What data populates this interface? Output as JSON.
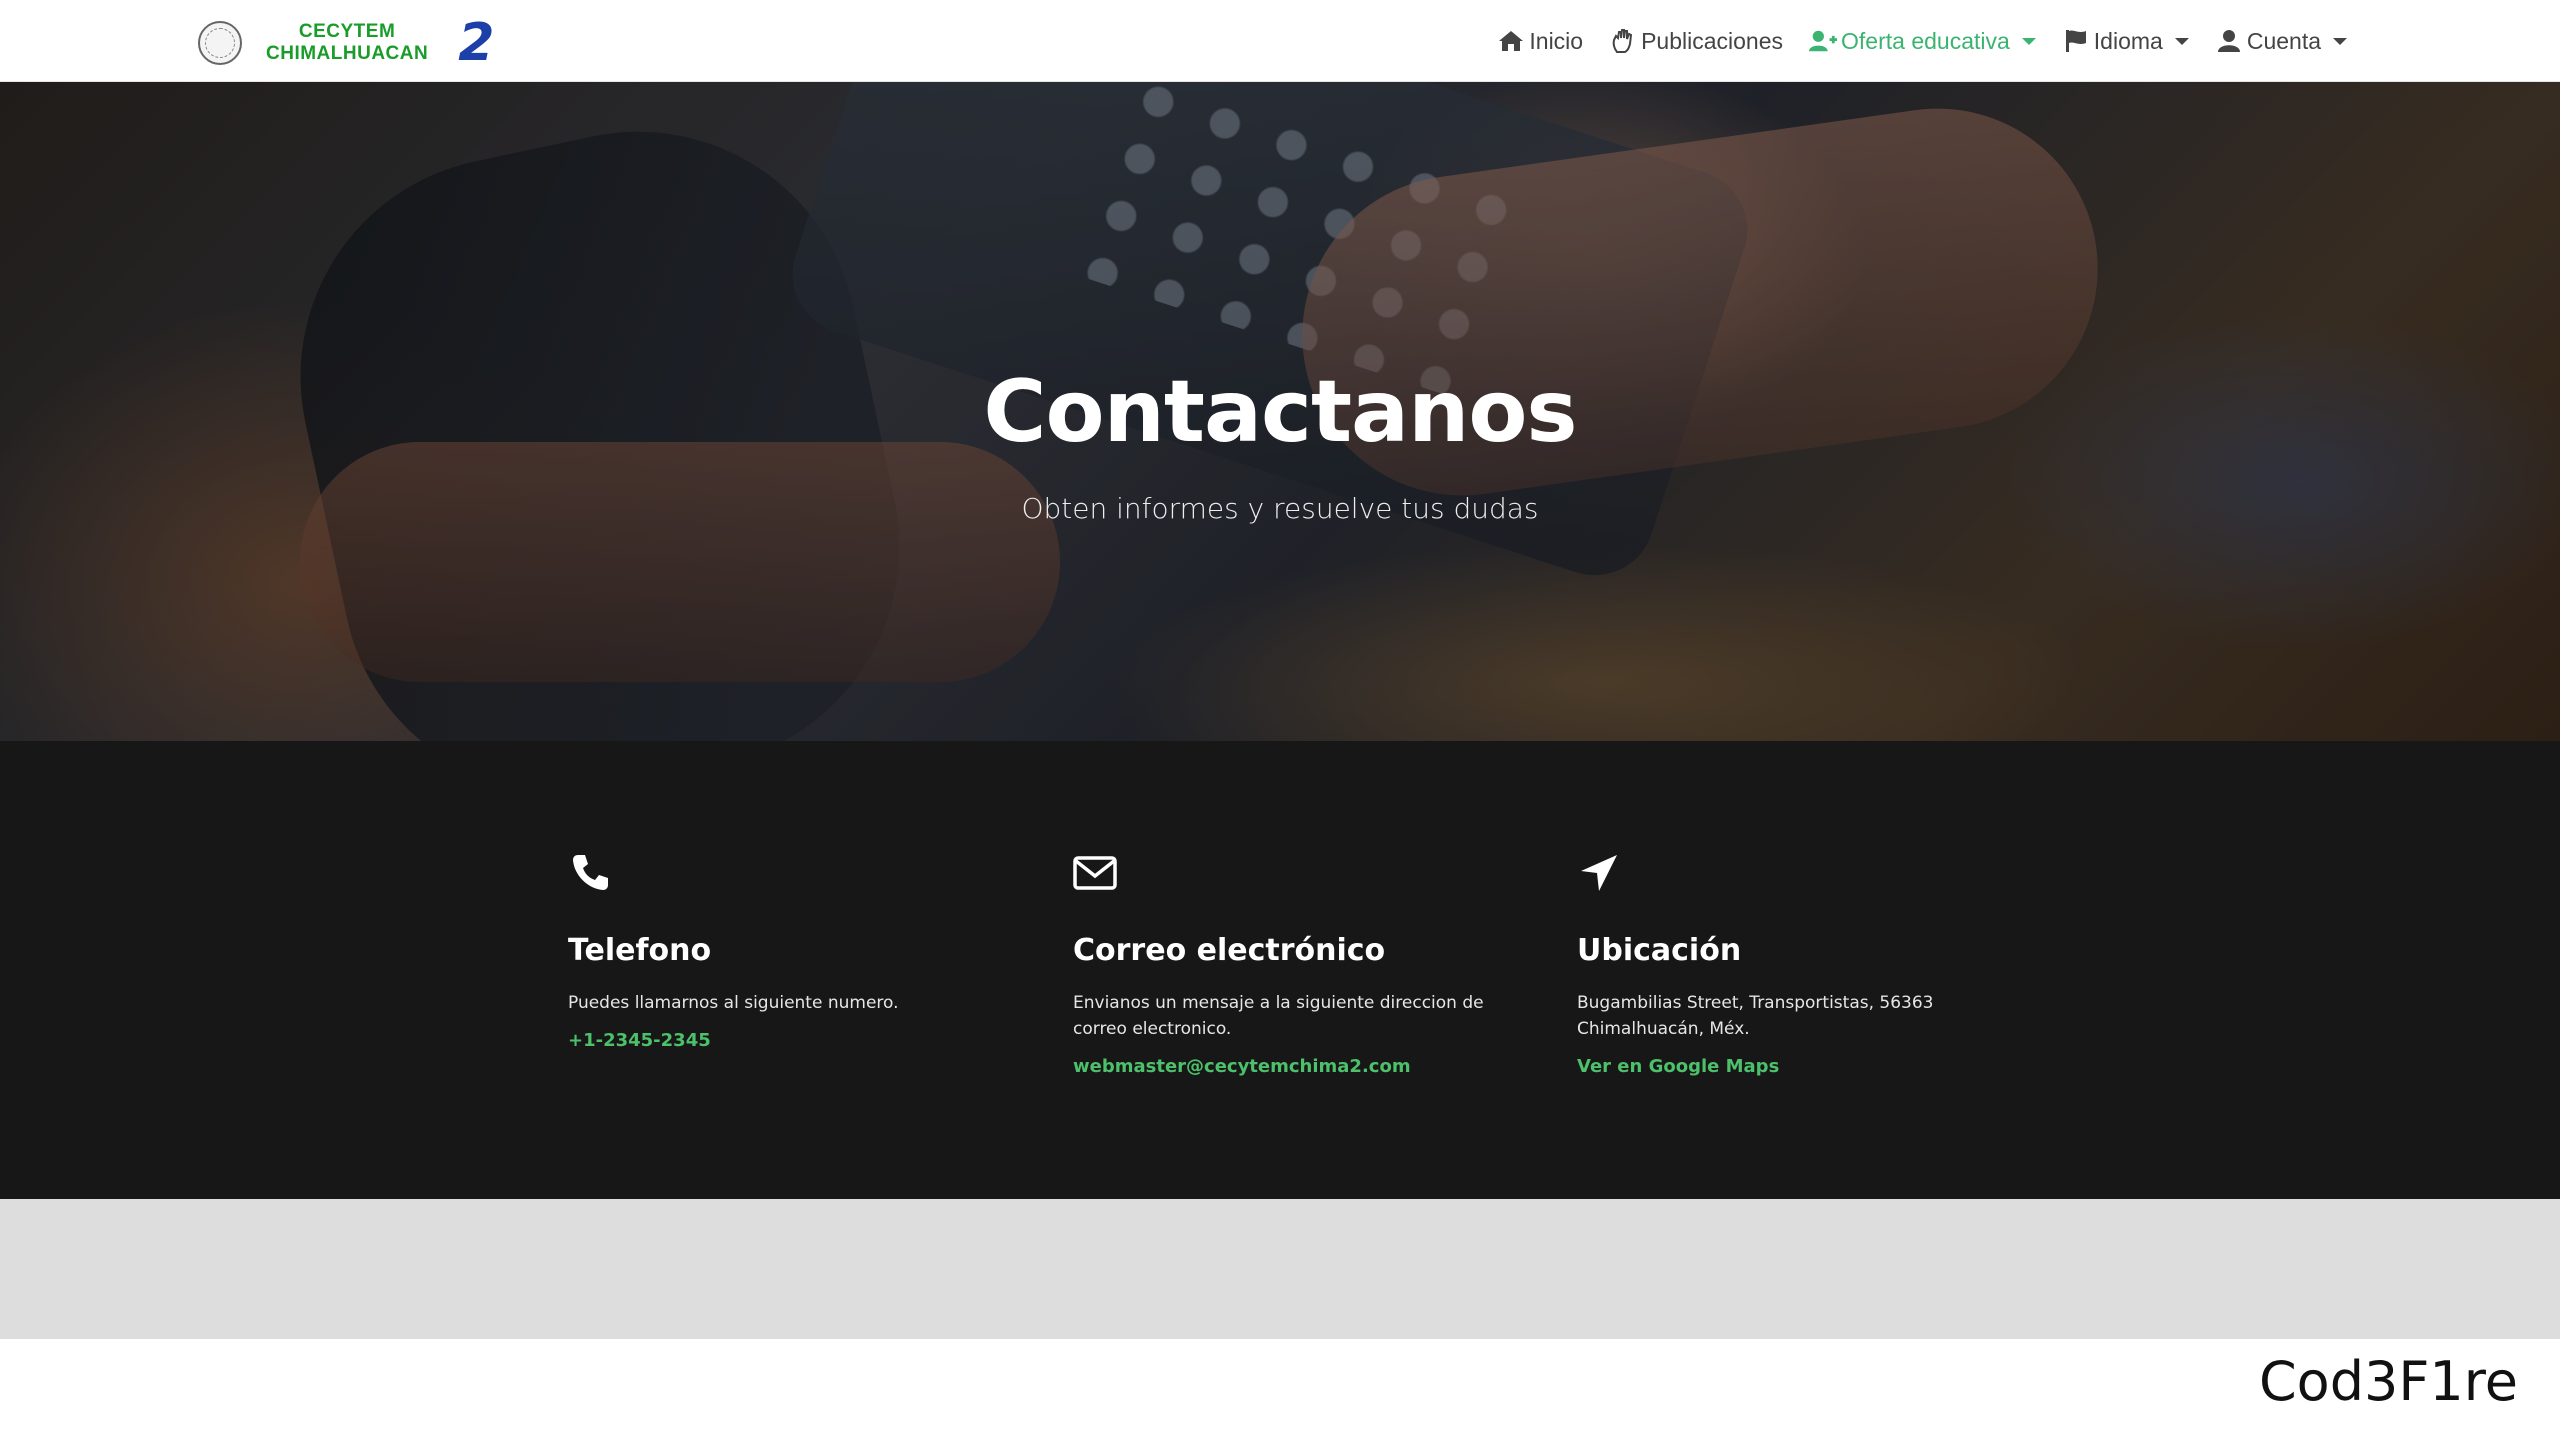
{
  "brand": {
    "line1": "CECYTEM",
    "line2": "CHIMALHUACAN",
    "number": "2"
  },
  "nav": {
    "items": [
      {
        "label": "Inicio",
        "icon": "home-icon"
      },
      {
        "label": "Publicaciones",
        "icon": "hand-icon"
      },
      {
        "label": "Oferta educativa",
        "icon": "user-plus-icon",
        "active": true
      },
      {
        "label": "Idioma",
        "icon": "flag-icon"
      },
      {
        "label": "Cuenta",
        "icon": "user-icon"
      }
    ],
    "active_color": "#3cb371"
  },
  "hero": {
    "title": "Contactanos",
    "subtitle": "Obten informes y resuelve tus dudas"
  },
  "contact": {
    "phone": {
      "title": "Telefono",
      "text": "Puedes llamarnos al siguiente numero.",
      "link": "+1-2345-2345"
    },
    "email": {
      "title": "Correo electrónico",
      "text": "Envianos un mensaje a la siguiente direccion de correo electronico.",
      "link": "webmaster@cecytemchima2.com"
    },
    "location": {
      "title": "Ubicación",
      "text": "Bugambilias Street, Transportistas, 56363 Chimalhuacán, Méx.",
      "link": "Ver en Google Maps"
    },
    "link_color": "#4cc06a"
  },
  "watermark": "Cod3F1re"
}
